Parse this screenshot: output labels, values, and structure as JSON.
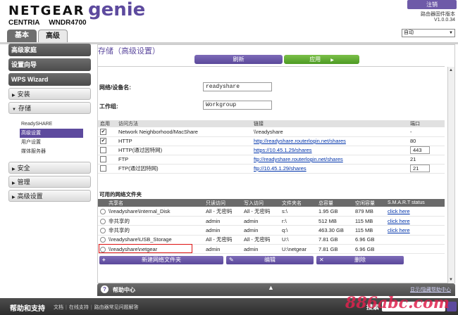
{
  "header": {
    "brand": "NETGEAR",
    "product": "genie",
    "series": "CENTRIA",
    "model": "WNDR4700",
    "logout": "注销",
    "firmware_label": "路由器固件版本",
    "firmware_version": "V1.0.0.34",
    "update_mode": "自动",
    "tabs": {
      "basic": "基本",
      "advanced": "高级"
    }
  },
  "sidebar": {
    "home": "高级家庭",
    "wizard": "设置向导",
    "wps": "WPS Wizard",
    "install": "安装",
    "storage": "存储",
    "storage_sub": [
      "ReadySHARE",
      "高级设置",
      "用户设置",
      "媒体服务器"
    ],
    "security": "安全",
    "admin": "管理",
    "advanced_setup": "高级设置"
  },
  "main": {
    "title": "存储（高级设置）",
    "refresh": "刷新",
    "apply": "应用",
    "device_name_label": "网络/设备名:",
    "device_name_value": "readyshare",
    "workgroup_label": "工作组:",
    "workgroup_value": "Workgroup",
    "access_headers": {
      "enable": "启用",
      "method": "访问方法",
      "link": "链接",
      "port": "端口"
    },
    "access_rows": [
      {
        "checked": true,
        "method": "Network Neighborhood/MacShare",
        "link": "\\\\readyshare",
        "port": "-"
      },
      {
        "checked": true,
        "method": "HTTP",
        "link": "http://readyshare.routerlogin.net/shares",
        "port": "80"
      },
      {
        "checked": false,
        "method": "HTTP(通过因特网)",
        "link": "https://10.45.1.29/shares",
        "port": "443"
      },
      {
        "checked": false,
        "method": "FTP",
        "link": "ftp://readyshare.routerlogin.net/shares",
        "port": "21"
      },
      {
        "checked": false,
        "method": "FTP(通过因特网)",
        "link": "ftp://10.45.1.29/shares",
        "port": "21"
      }
    ],
    "shares_title": "可用的网络文件夹",
    "shares_headers": {
      "share": "共享名",
      "read": "只读访问",
      "write": "写入访问",
      "folder": "文件夹名",
      "total": "总容量",
      "free": "空闲容量",
      "smart": "S.M.A.R.T status"
    },
    "shares_rows": [
      {
        "share": "\\\\readyshare\\Internal_Disk",
        "read": "All - 无密码",
        "write": "All - 无密码",
        "folder": "s:\\",
        "total": "1.95 GB",
        "free": "879 MB",
        "smart": "click here"
      },
      {
        "share": "非共享的",
        "read": "admin",
        "write": "admin",
        "folder": "r:\\",
        "total": "512 MB",
        "free": "115 MB",
        "smart": "click here"
      },
      {
        "share": "非共享的",
        "read": "admin",
        "write": "admin",
        "folder": "q:\\",
        "total": "463.30 GB",
        "free": "115 MB",
        "smart": "click here"
      },
      {
        "share": "\\\\readyshare\\USB_Storage",
        "read": "All - 无密码",
        "write": "All - 无密码",
        "folder": "U:\\",
        "total": "7.81 GB",
        "free": "6.96 GB",
        "smart": ""
      },
      {
        "share": "\\\\readyshare\\netgear",
        "read": "admin",
        "write": "admin",
        "folder": "U:\\netgear",
        "total": "7.81 GB",
        "free": "6.96 GB",
        "smart": ""
      }
    ],
    "btn_new": "新建网络文件夹",
    "btn_edit": "编辑",
    "btn_delete": "删除"
  },
  "help": {
    "title": "帮助中心",
    "show": "显示/隐藏帮助中心"
  },
  "footer": {
    "title": "帮助和支持",
    "links": [
      "文档",
      "在线支持",
      "路由器常见问题解答"
    ],
    "search": "搜索"
  },
  "watermark": "886abc.com",
  "colors": {
    "accent": "#5d4a9e",
    "apply_green": "#5ba82e",
    "highlight_red": "#d11111"
  }
}
